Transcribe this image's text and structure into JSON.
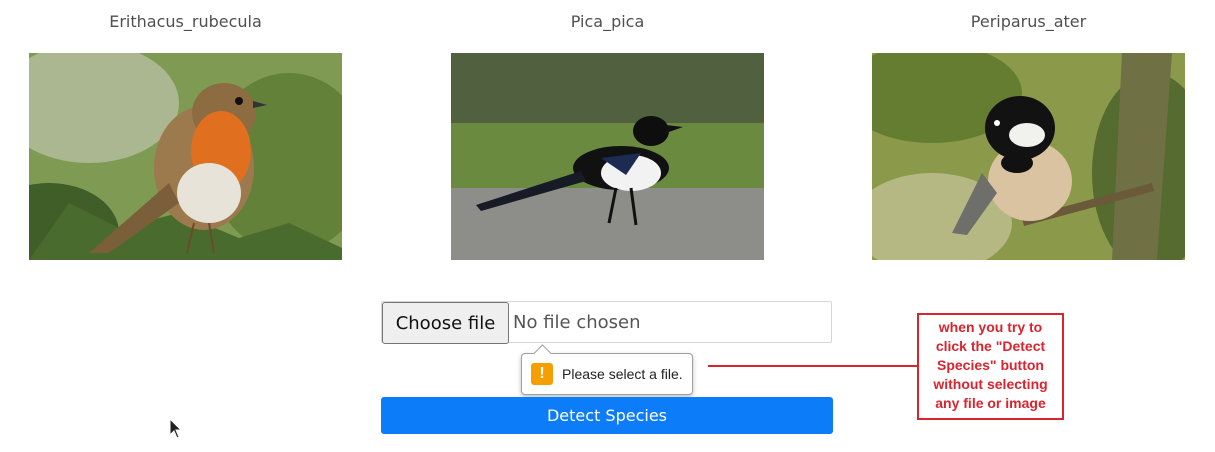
{
  "gallery": [
    {
      "name": "Erithacus_rubecula"
    },
    {
      "name": "Pica_pica"
    },
    {
      "name": "Periparus_ater"
    }
  ],
  "upload": {
    "choose_label": "Choose file",
    "status_text": "No file chosen"
  },
  "validation": {
    "message": "Please select a file.",
    "icon": "!"
  },
  "detect_button": {
    "label": "Detect Species"
  },
  "annotation": {
    "lines": [
      "when you try to",
      "click the \"Detect",
      "Species\" button",
      "without selecting",
      "any file or image"
    ]
  },
  "colors": {
    "primary": "#0d7cf8",
    "annotation": "#d8242e",
    "warning": "#f5a000"
  }
}
